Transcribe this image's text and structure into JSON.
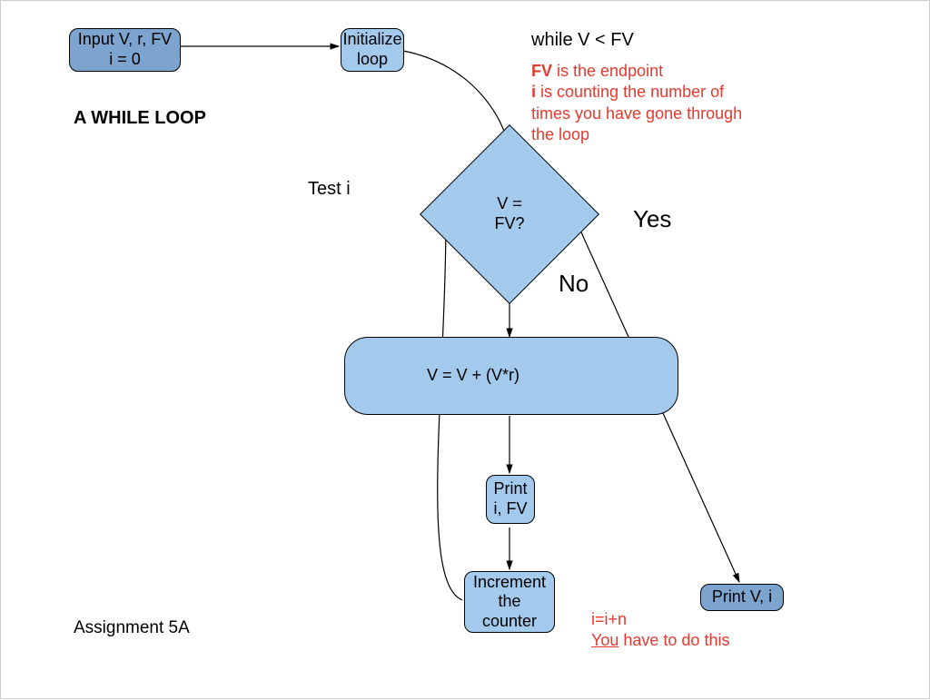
{
  "nodes": {
    "input": {
      "line1": "Input V, r, FV",
      "line2": "i = 0"
    },
    "init": {
      "line1": "Initialize",
      "line2": "loop"
    },
    "decision": {
      "line1": "V =",
      "line2": "FV?"
    },
    "process": "V = V + (V*r)",
    "print1": {
      "line1": "Print",
      "line2": "i, FV"
    },
    "increment": {
      "line1": "Increment",
      "line2": "the",
      "line3": "counter"
    },
    "print2": "Print V, i"
  },
  "labels": {
    "while_cond": "while V < FV",
    "note_top_l1_b": "FV",
    "note_top_l1_r": " is the endpoint",
    "note_top_l2_b": "i",
    "note_top_l2_r": " is counting the number of",
    "note_top_l3": "times you have gone through",
    "note_top_l4": "the loop",
    "heading": "A WHILE LOOP",
    "test_i": "Test i",
    "yes": "Yes",
    "no": "No",
    "assignment": "Assignment 5A",
    "note_bot_l1": "i=i+n",
    "note_bot_l2_u": "You",
    "note_bot_l2_r": " have to do this"
  }
}
